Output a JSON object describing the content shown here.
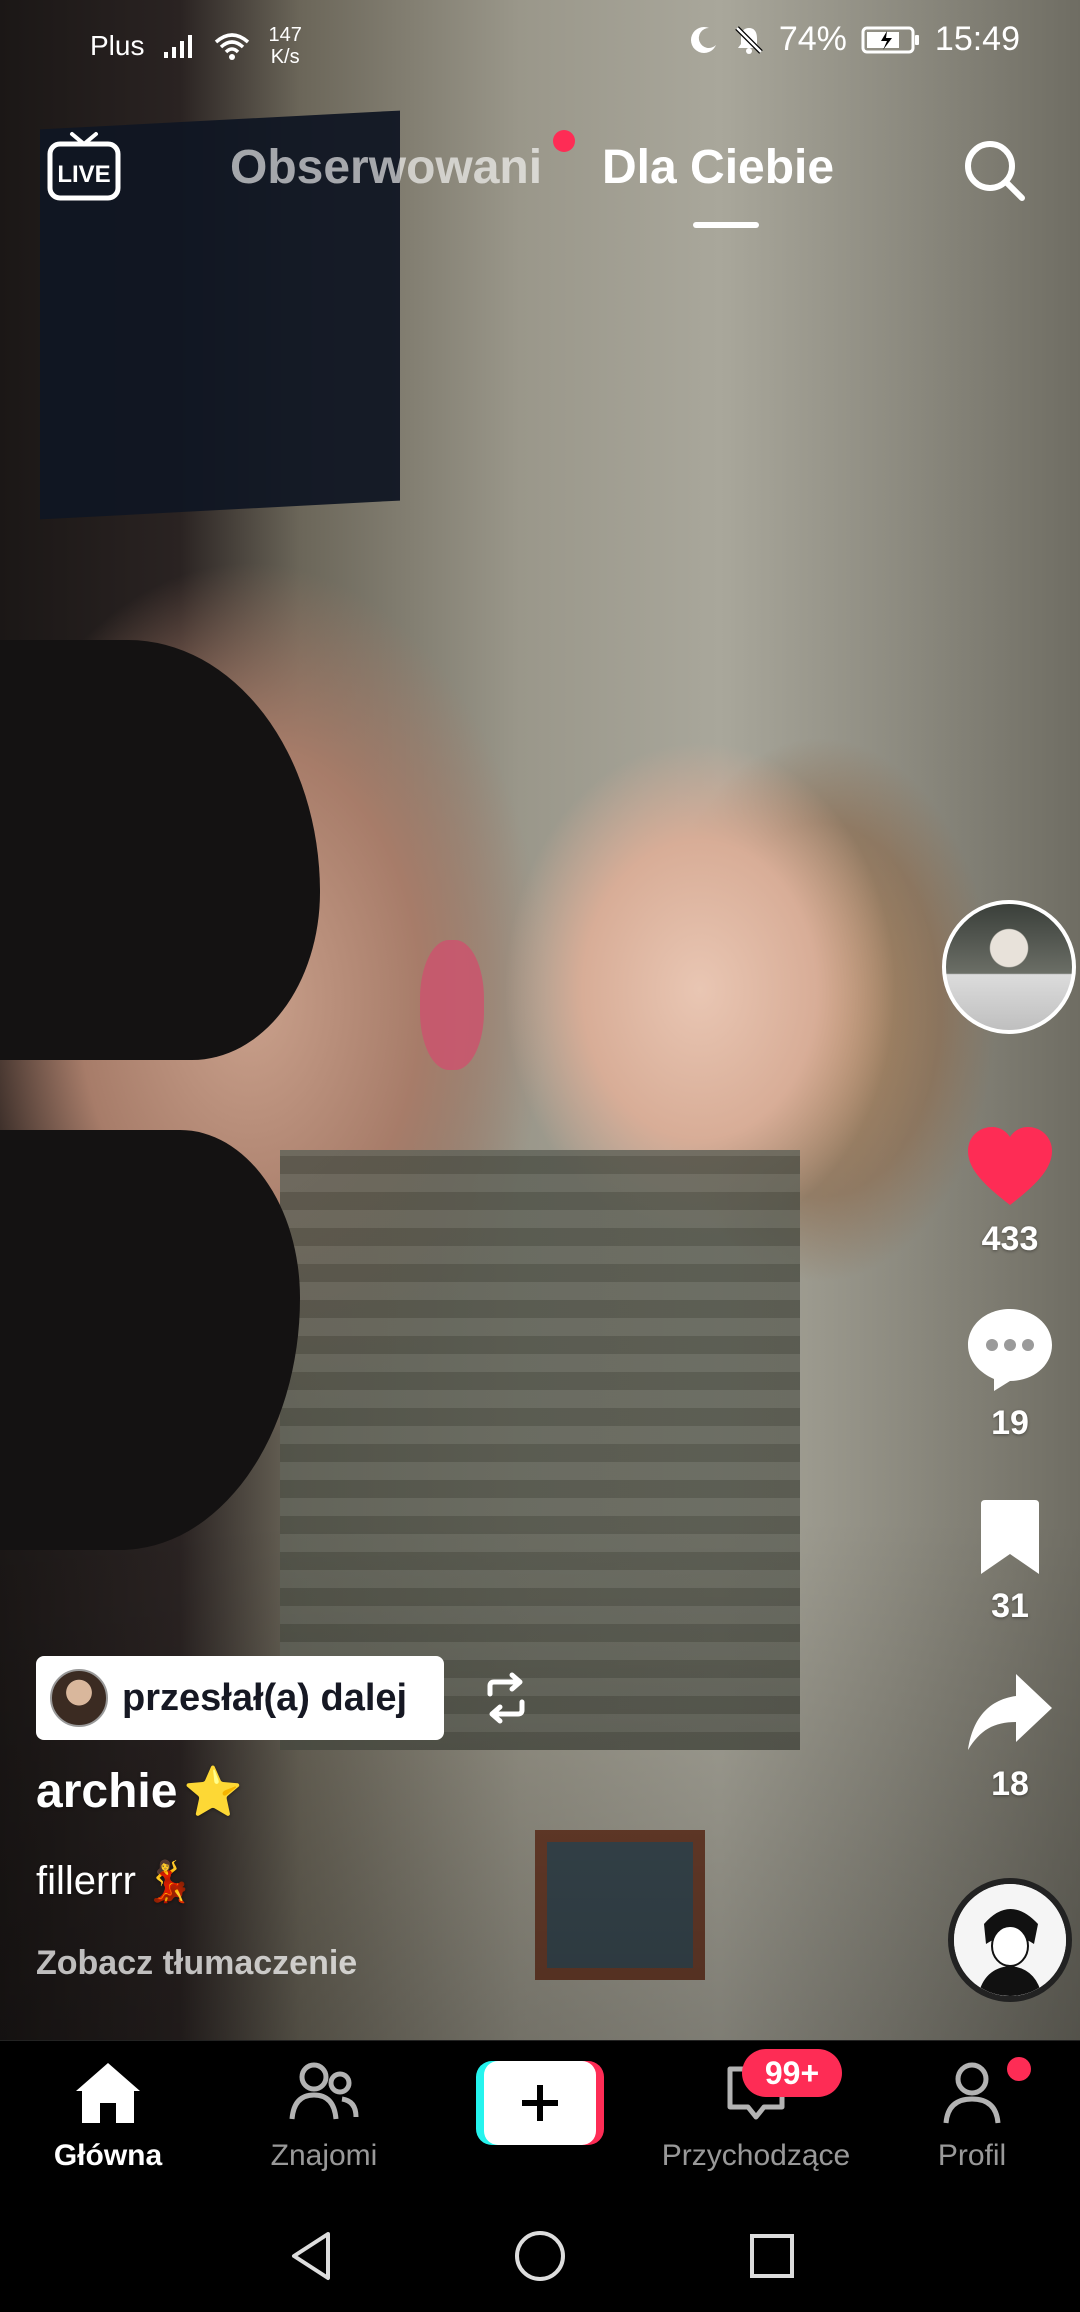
{
  "status_bar": {
    "carrier": "Plus",
    "net_speed_value": "147",
    "net_speed_unit": "K/s",
    "battery": "74%",
    "time": "15:49"
  },
  "top_nav": {
    "live_label": "LIVE",
    "tabs": [
      {
        "label": "Obserwowani",
        "active": false,
        "has_dot": true
      },
      {
        "label": "Dla Ciebie",
        "active": true
      }
    ]
  },
  "actions": {
    "likes": "433",
    "comments": "19",
    "saves": "31",
    "shares": "18"
  },
  "post": {
    "repost_label": "przesłał(a) dalej",
    "username": "archie",
    "username_emoji": "⭐",
    "caption": "fillerrr",
    "caption_emoji": "💃",
    "translate_label": "Zobacz tłumaczenie"
  },
  "bottom_nav": {
    "home": "Główna",
    "friends": "Znajomi",
    "inbox": "Przychodzące",
    "inbox_badge": "99+",
    "profile": "Profil"
  },
  "colors": {
    "accent": "#fe2c55",
    "cyan": "#25f4ee",
    "like_red": "#fe2c55"
  }
}
